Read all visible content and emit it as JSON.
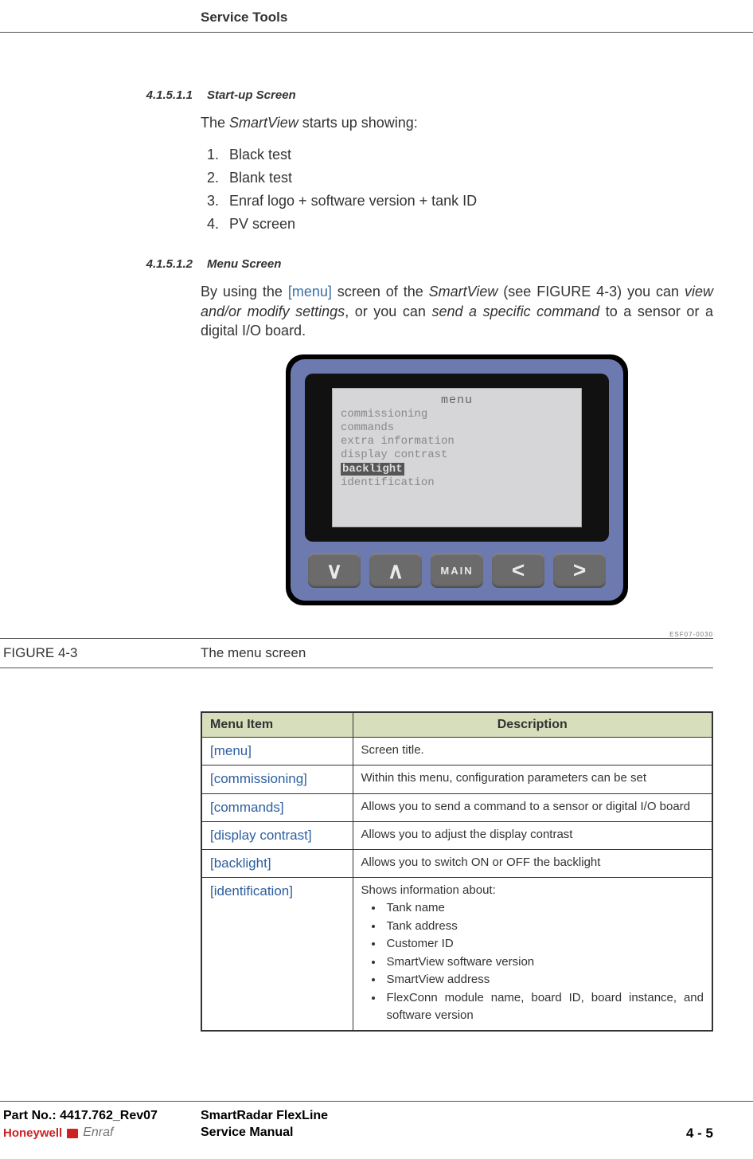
{
  "header": {
    "section_title": "Service Tools"
  },
  "sections": {
    "s1": {
      "num": "4.1.5.1.1",
      "title": "Start-up Screen",
      "intro_pre": "The ",
      "intro_em": "SmartView",
      "intro_post": " starts up showing:",
      "items": [
        "Black test",
        "Blank test",
        "Enraf logo + software version + tank ID",
        "PV screen"
      ]
    },
    "s2": {
      "num": "4.1.5.1.2",
      "title": "Menu Screen",
      "p1_a": "By using the ",
      "p1_tag": "[menu]",
      "p1_b": " screen of the ",
      "p1_em1": "SmartView",
      "p1_c": " (see FIGURE 4-3) you can ",
      "p1_em2": "view and/or modify settings",
      "p1_d": ", or you can ",
      "p1_em3": "send a specific command",
      "p1_e": " to a sensor or a digital I/O board."
    }
  },
  "device": {
    "screen": {
      "title": "menu",
      "lines": [
        "commissioning",
        "commands",
        "extra information",
        "display contrast",
        "backlight",
        "identification"
      ],
      "highlighted": "backlight"
    },
    "buttons": {
      "down": "∨",
      "up": "∧",
      "main": "MAIN",
      "left": "<",
      "right": ">"
    }
  },
  "figure": {
    "ref": "ESF07-0030",
    "label": "FIGURE  4-3",
    "caption": "The menu screen"
  },
  "table": {
    "headers": {
      "item": "Menu Item",
      "desc": "Description"
    },
    "rows": [
      {
        "item": "[menu]",
        "desc": "Screen title."
      },
      {
        "item": "[commissioning]",
        "desc": "Within this menu, configuration parameters can be set"
      },
      {
        "item": "[commands]",
        "desc": "Allows you to send a command to a sensor or digital I/O board"
      },
      {
        "item": "[display contrast]",
        "desc": "Allows you to adjust the display contrast"
      },
      {
        "item": "[backlight]",
        "desc": "Allows you to switch ON or OFF the backlight"
      },
      {
        "item": "[identification]",
        "desc_intro": "Shows information about:",
        "bullets": [
          "Tank name",
          "Tank address",
          "Customer ID",
          "SmartView software version",
          "SmartView address",
          "FlexConn module name, board ID, board instance, and software version"
        ]
      }
    ]
  },
  "footer": {
    "partno_label": "Part No.: ",
    "partno": "4417.762_Rev07",
    "brand1": "Honeywell",
    "brand2": "Enraf",
    "doc1": "SmartRadar FlexLine",
    "doc2": "Service Manual",
    "page": "4 - 5"
  }
}
